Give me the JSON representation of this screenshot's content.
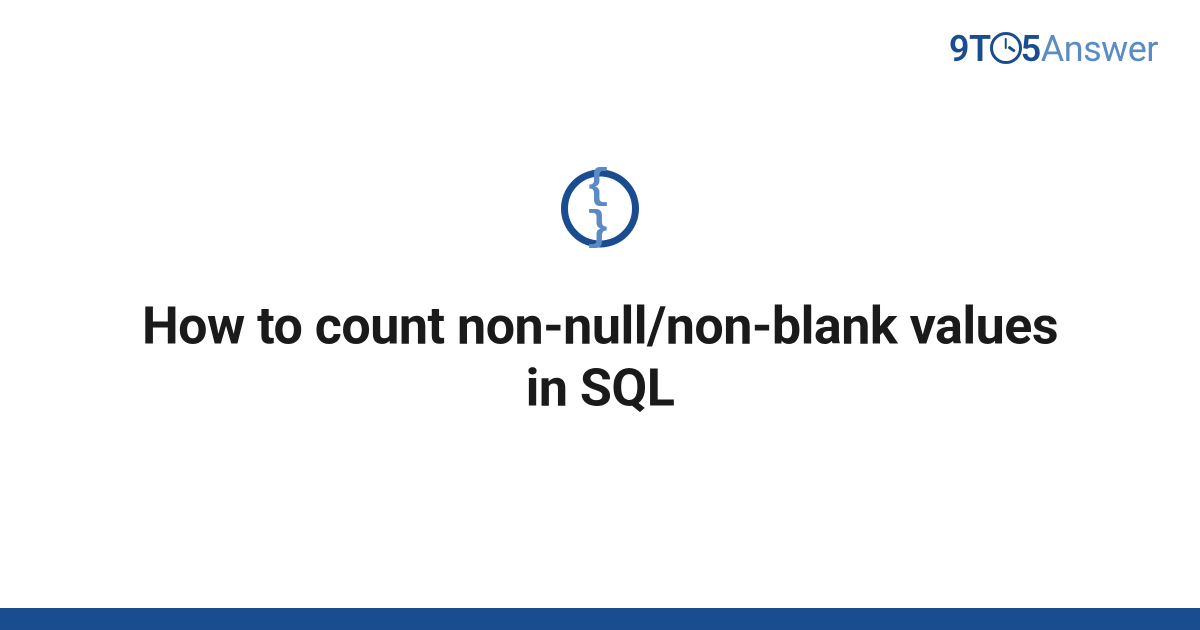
{
  "logo": {
    "prefix": "9T",
    "middle": "5",
    "suffix": "Answer"
  },
  "category": {
    "icon_name": "code-braces",
    "icon_glyph": "{ }"
  },
  "title": "How to count non-null/non-blank values in SQL",
  "colors": {
    "primary": "#1a4d8f",
    "secondary": "#5a8bc4"
  }
}
